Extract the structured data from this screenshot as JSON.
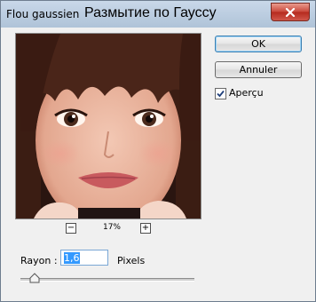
{
  "window": {
    "title": "Flou gaussien"
  },
  "overlay_caption": "Размытие по Гауссу",
  "preview": {
    "zoom_label": "17%",
    "zoom_out_symbol": "−",
    "zoom_in_symbol": "+"
  },
  "buttons": {
    "ok_label": "OK",
    "cancel_label": "Annuler"
  },
  "preview_checkbox": {
    "label": "Aperçu",
    "checked": true
  },
  "radius": {
    "label": "Rayon :",
    "value": "1,6",
    "unit": "Pixels"
  },
  "slider": {
    "value": 1.6
  },
  "colors": {
    "titlebar": "#afc3d8",
    "close_button": "#c9463a",
    "selection": "#3399ff"
  }
}
